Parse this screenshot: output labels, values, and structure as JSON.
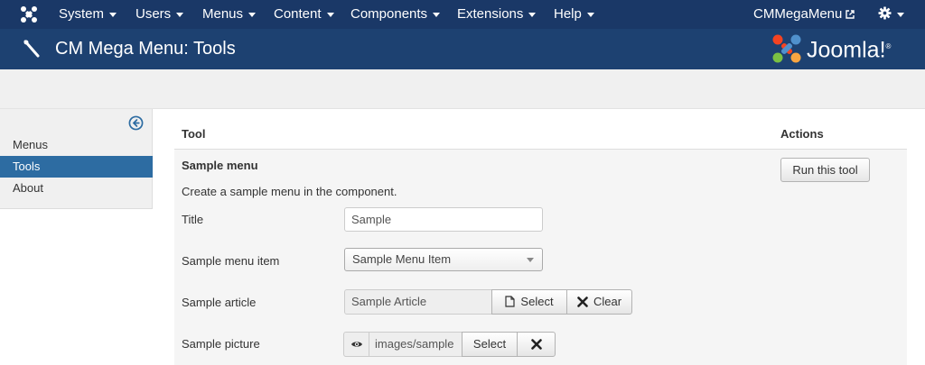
{
  "navbar": {
    "menus": [
      "System",
      "Users",
      "Menus",
      "Content",
      "Components",
      "Extensions",
      "Help"
    ],
    "site_link": "CMMegaMenu"
  },
  "titlebar": {
    "title": "CM Mega Menu: Tools",
    "brand": "Joomla!",
    "trademark": "®"
  },
  "sidebar": {
    "items": [
      {
        "label": "Menus",
        "active": false
      },
      {
        "label": "Tools",
        "active": true
      },
      {
        "label": "About",
        "active": false
      }
    ]
  },
  "table": {
    "headers": {
      "tool": "Tool",
      "actions": "Actions"
    },
    "row": {
      "title": "Sample menu",
      "description": "Create a sample menu in the component.",
      "run_button": "Run this tool",
      "fields": {
        "title": {
          "label": "Title",
          "value": "Sample"
        },
        "menu_item": {
          "label": "Sample menu item",
          "value": "Sample Menu Item"
        },
        "article": {
          "label": "Sample article",
          "value": "Sample Article",
          "select_label": "Select",
          "clear_label": "Clear"
        },
        "picture": {
          "label": "Sample picture",
          "value": "images/sample",
          "select_label": "Select"
        }
      }
    }
  },
  "colors": {
    "navbar_bg": "#1a3867",
    "titlebar_bg": "#1d4171",
    "sidebar_active": "#2d6ca2",
    "toggle_icon": "#2d6ca2"
  }
}
